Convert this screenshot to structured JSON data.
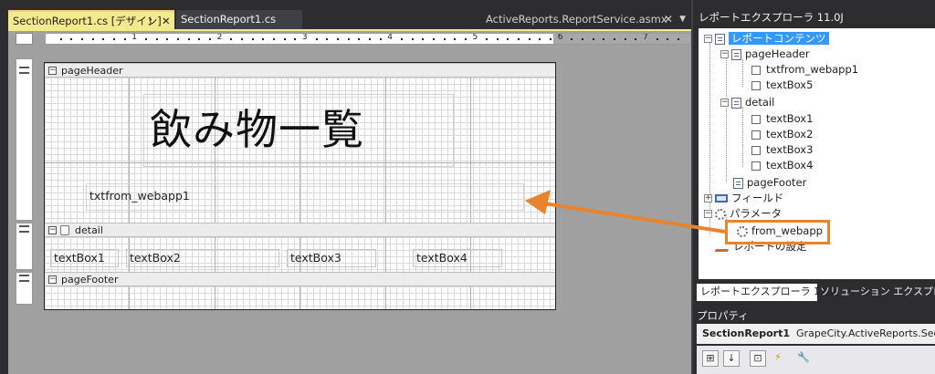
{
  "tabs": {
    "active": {
      "label": "SectionReport1.cs [デザイン]",
      "pin_glyph": "ᚬ",
      "close_glyph": "✕"
    },
    "second": {
      "label": "SectionReport1.cs"
    },
    "right": {
      "label": "ActiveReports.ReportService.asmx",
      "close_glyph": "✕",
      "menu_glyph": "▼"
    }
  },
  "ruler": {
    "numbers": [
      "1",
      "2",
      "3",
      "4",
      "5",
      "6",
      "7"
    ]
  },
  "report": {
    "sections": {
      "page_header": {
        "label": "pageHeader",
        "toggle": "−"
      },
      "detail": {
        "label": "detail",
        "toggle": "−"
      },
      "page_footer": {
        "label": "pageFooter",
        "toggle": "−"
      }
    },
    "controls": {
      "title": "飲み物一覧",
      "txtfrom_webapp1": "txtfrom_webapp1",
      "textBox1": "textBox1",
      "textBox2": "textBox2",
      "textBox3": "textBox3",
      "textBox4": "textBox4"
    }
  },
  "explorer": {
    "title": "レポートエクスプローラ 11.0J",
    "tree": {
      "root": "レポートコンテンツ",
      "page_header": "pageHeader",
      "txtfrom_webapp1": "txtfrom_webapp1",
      "textBox5": "textBox5",
      "detail": "detail",
      "textBox1": "textBox1",
      "textBox2": "textBox2",
      "textBox3": "textBox3",
      "textBox4": "textBox4",
      "page_footer": "pageFooter",
      "fields": "フィールド",
      "parameters": "パラメータ",
      "from_webapp": "from_webapp",
      "report_settings": "レポートの設定"
    },
    "tabs": {
      "active": "レポートエクスプローラ 11.0J",
      "other": "ソリューション エクスプローラー"
    }
  },
  "properties": {
    "title": "プロパティ",
    "object_name": "SectionReport1",
    "object_type": "GrapeCity.ActiveReports.SectionR",
    "toolbar_glyphs": [
      "⊞",
      "↓",
      "⊡",
      "⚡",
      "🔧"
    ]
  },
  "colors": {
    "arrow": "#e8842e",
    "highlight": "#e8842e",
    "selection": "#3399ff",
    "tab_active": "#f5e98e"
  }
}
